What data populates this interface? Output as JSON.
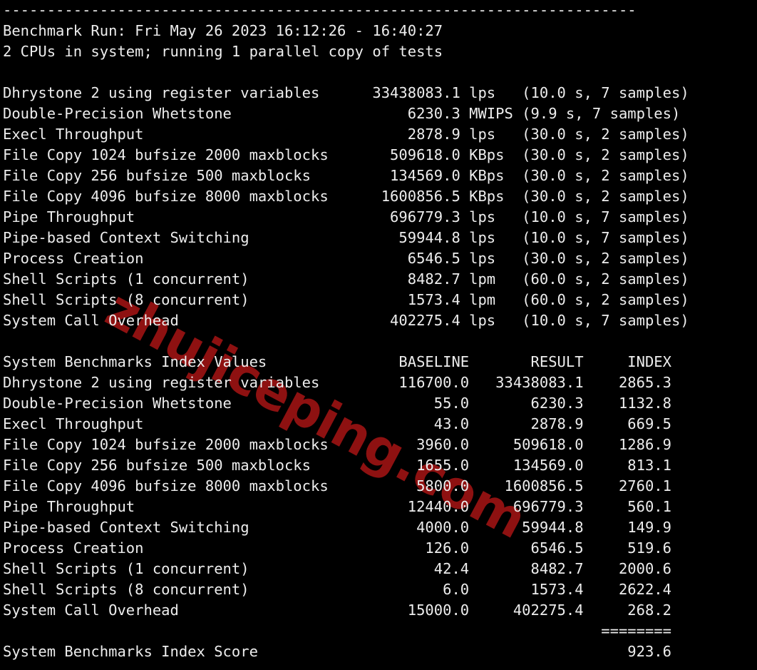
{
  "terminal": {
    "background_color": "#000000",
    "text_color": "#EDEDED",
    "watermark_color": "#8E1111",
    "watermark_text": "zhujiceping.com",
    "separator_top": "------------------------------------------------------------------------",
    "separator_score": "========"
  },
  "header": {
    "run_line": "Benchmark Run: Fri May 26 2023 16:12:26 - 16:40:27",
    "cpu_line": "2 CPUs in system; running 1 parallel copy of tests",
    "run_label": "Benchmark Run:",
    "date": "Fri May 26 2023",
    "start_time": "16:12:26",
    "end_time": "16:40:27",
    "cpu_count": "2",
    "parallel_copies": "1"
  },
  "raw_results": {
    "rows": [
      {
        "name": "Dhrystone 2 using register variables",
        "value": "33438083.1",
        "unit": "lps",
        "duration": "10.0 s",
        "samples": "7 samples"
      },
      {
        "name": "Double-Precision Whetstone",
        "value": "6230.3",
        "unit": "MWIPS",
        "duration": "9.9 s",
        "samples": "7 samples"
      },
      {
        "name": "Execl Throughput",
        "value": "2878.9",
        "unit": "lps",
        "duration": "30.0 s",
        "samples": "2 samples"
      },
      {
        "name": "File Copy 1024 bufsize 2000 maxblocks",
        "value": "509618.0",
        "unit": "KBps",
        "duration": "30.0 s",
        "samples": "2 samples"
      },
      {
        "name": "File Copy 256 bufsize 500 maxblocks",
        "value": "134569.0",
        "unit": "KBps",
        "duration": "30.0 s",
        "samples": "2 samples"
      },
      {
        "name": "File Copy 4096 bufsize 8000 maxblocks",
        "value": "1600856.5",
        "unit": "KBps",
        "duration": "30.0 s",
        "samples": "2 samples"
      },
      {
        "name": "Pipe Throughput",
        "value": "696779.3",
        "unit": "lps",
        "duration": "10.0 s",
        "samples": "7 samples"
      },
      {
        "name": "Pipe-based Context Switching",
        "value": "59944.8",
        "unit": "lps",
        "duration": "10.0 s",
        "samples": "7 samples"
      },
      {
        "name": "Process Creation",
        "value": "6546.5",
        "unit": "lps",
        "duration": "30.0 s",
        "samples": "2 samples"
      },
      {
        "name": "Shell Scripts (1 concurrent)",
        "value": "8482.7",
        "unit": "lpm",
        "duration": "60.0 s",
        "samples": "2 samples"
      },
      {
        "name": "Shell Scripts (8 concurrent)",
        "value": "1573.4",
        "unit": "lpm",
        "duration": "60.0 s",
        "samples": "2 samples"
      },
      {
        "name": "System Call Overhead",
        "value": "402275.4",
        "unit": "lps",
        "duration": "10.0 s",
        "samples": "7 samples"
      }
    ]
  },
  "index_table": {
    "title": "System Benchmarks Index Values",
    "columns": [
      "BASELINE",
      "RESULT",
      "INDEX"
    ],
    "rows": [
      {
        "name": "Dhrystone 2 using register variables",
        "baseline": "116700.0",
        "result": "33438083.1",
        "index": "2865.3"
      },
      {
        "name": "Double-Precision Whetstone",
        "baseline": "55.0",
        "result": "6230.3",
        "index": "1132.8"
      },
      {
        "name": "Execl Throughput",
        "baseline": "43.0",
        "result": "2878.9",
        "index": "669.5"
      },
      {
        "name": "File Copy 1024 bufsize 2000 maxblocks",
        "baseline": "3960.0",
        "result": "509618.0",
        "index": "1286.9"
      },
      {
        "name": "File Copy 256 bufsize 500 maxblocks",
        "baseline": "1655.0",
        "result": "134569.0",
        "index": "813.1"
      },
      {
        "name": "File Copy 4096 bufsize 8000 maxblocks",
        "baseline": "5800.0",
        "result": "1600856.5",
        "index": "2760.1"
      },
      {
        "name": "Pipe Throughput",
        "baseline": "12440.0",
        "result": "696779.3",
        "index": "560.1"
      },
      {
        "name": "Pipe-based Context Switching",
        "baseline": "4000.0",
        "result": "59944.8",
        "index": "149.9"
      },
      {
        "name": "Process Creation",
        "baseline": "126.0",
        "result": "6546.5",
        "index": "519.6"
      },
      {
        "name": "Shell Scripts (1 concurrent)",
        "baseline": "42.4",
        "result": "8482.7",
        "index": "2000.6"
      },
      {
        "name": "Shell Scripts (8 concurrent)",
        "baseline": "6.0",
        "result": "1573.4",
        "index": "2622.4"
      },
      {
        "name": "System Call Overhead",
        "baseline": "15000.0",
        "result": "402275.4",
        "index": "268.2"
      }
    ]
  },
  "score": {
    "label": "System Benchmarks Index Score",
    "value": "923.6"
  }
}
